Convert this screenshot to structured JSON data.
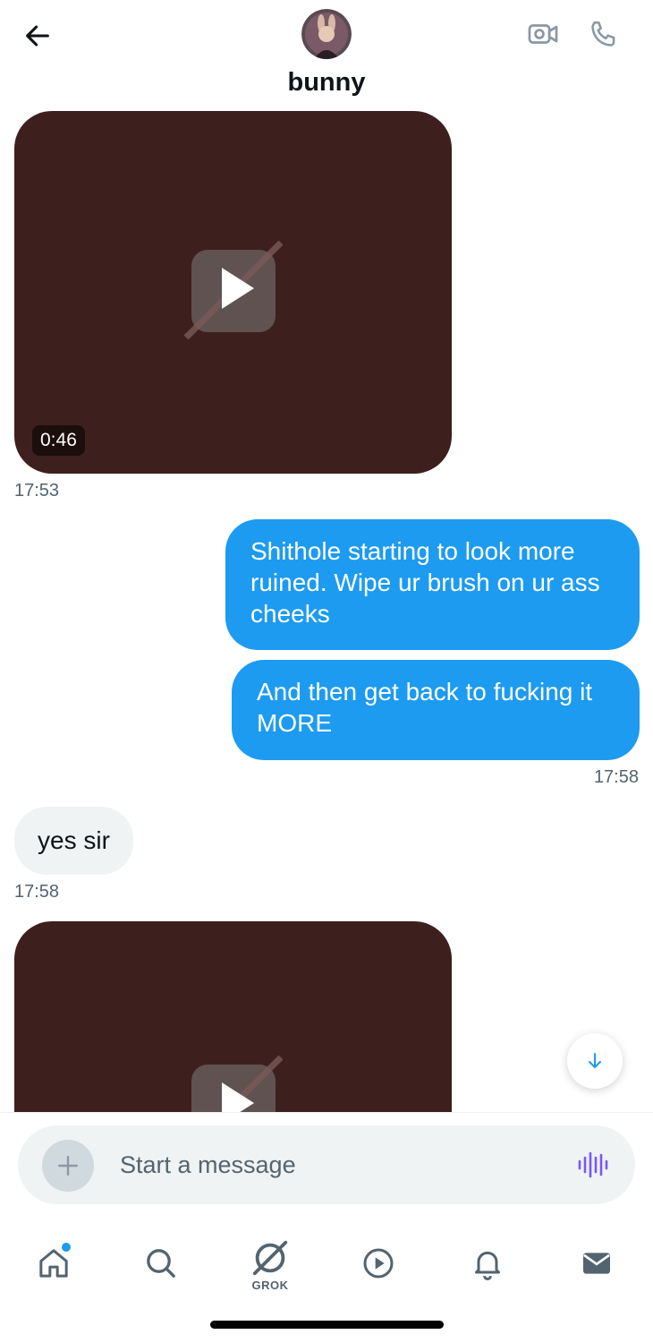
{
  "header": {
    "contact_name": "bunny"
  },
  "messages": {
    "video_1": {
      "duration": "0:46",
      "time": "17:53"
    },
    "outgoing_1": "Shithole starting to look more ruined. Wipe ur brush on ur ass cheeks",
    "outgoing_2": "And then get back to fucking it MORE",
    "outgoing_time": "17:58",
    "incoming_1": "yes sir",
    "incoming_time": "17:58"
  },
  "composer": {
    "placeholder": "Start a message"
  },
  "nav": {
    "grok_label": "GROK"
  },
  "colors": {
    "accent": "#1d9bf0",
    "incoming_bubble": "#eff3f4",
    "video_background": "#3d201e",
    "voice_icon": "#7856ff",
    "secondary_text": "#536471"
  },
  "icons": {
    "header": [
      "back-arrow-icon",
      "video-call-icon",
      "phone-icon"
    ],
    "media": [
      "play-icon",
      "scroll-down-arrow-icon"
    ],
    "composer": [
      "plus-icon",
      "voice-waveform-icon"
    ],
    "nav": [
      "home-icon",
      "search-icon",
      "grok-icon",
      "video-tab-icon",
      "bell-icon",
      "mail-icon"
    ]
  }
}
